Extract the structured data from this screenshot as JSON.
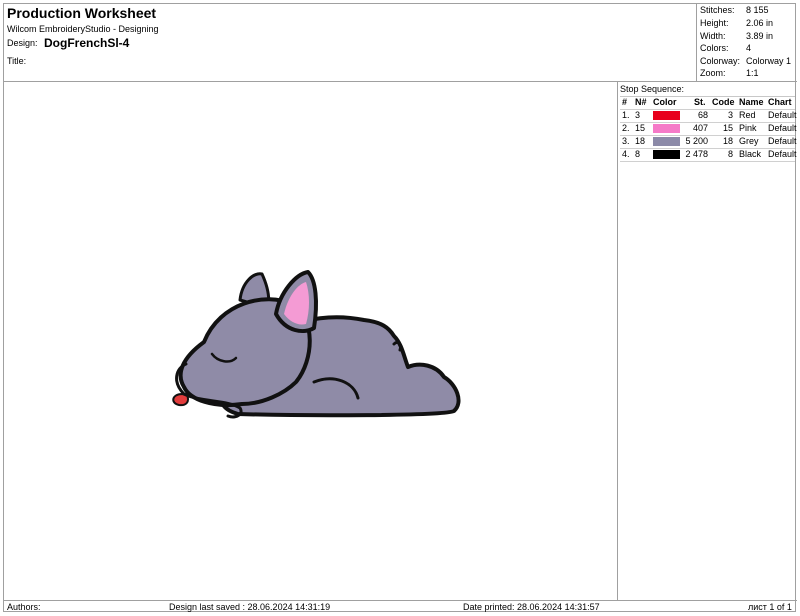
{
  "header": {
    "title": "Production Worksheet",
    "subtitle": "Wilcom EmbroideryStudio - Designing",
    "design_label": "Design:",
    "design_name": "DogFrenchSl-4",
    "title_label": "Title:"
  },
  "stats": [
    {
      "label": "Stitches:",
      "value": "8 155"
    },
    {
      "label": "Height:",
      "value": "2.06 in"
    },
    {
      "label": "Width:",
      "value": "3.89 in"
    },
    {
      "label": "Colors:",
      "value": "4"
    },
    {
      "label": "Colorway:",
      "value": "Colorway 1"
    },
    {
      "label": "Zoom:",
      "value": "1:1"
    }
  ],
  "stop_sequence": {
    "header": "Stop Sequence:",
    "columns": [
      "#",
      "N#",
      "Color",
      "St.",
      "Code",
      "Name",
      "Chart"
    ],
    "rows": [
      {
        "index": "1.",
        "needle": "3",
        "color": "#e8001c",
        "stitches": "68",
        "code": "3",
        "name": "Red",
        "chart": "Default"
      },
      {
        "index": "2.",
        "needle": "15",
        "color": "#f57ac8",
        "stitches": "407",
        "code": "15",
        "name": "Pink",
        "chart": "Default"
      },
      {
        "index": "3.",
        "needle": "18",
        "color": "#8c8aa8",
        "stitches": "5 200",
        "code": "18",
        "name": "Grey",
        "chart": "Default"
      },
      {
        "index": "4.",
        "needle": "8",
        "color": "#000000",
        "stitches": "2 478",
        "code": "8",
        "name": "Black",
        "chart": "Default"
      }
    ]
  },
  "footer": {
    "authors": "Authors:",
    "last_saved": "Design last saved : 28.06.2024 14:31:19",
    "printed": "Date printed: 28.06.2024 14:31:57",
    "page": "лист 1 of 1"
  },
  "design_colors": {
    "body": "#8f8ba7",
    "outline": "#111111",
    "ear_inner": "#f49bd4",
    "tongue": "#e23c3c"
  }
}
